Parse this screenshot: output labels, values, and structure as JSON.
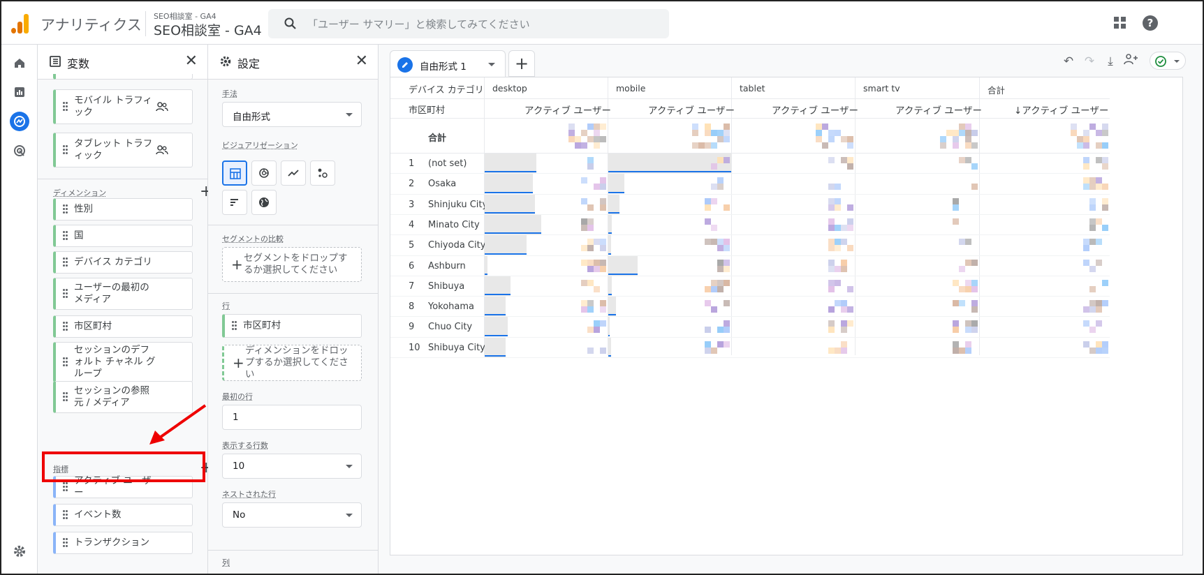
{
  "topbar": {
    "app_name": "アナリティクス",
    "account_small": "SEO相談室 - GA4",
    "account_big": "SEO相談室 - GA4",
    "search_placeholder": "「ユーザー サマリー」と検索してみてください",
    "colors": {
      "logo_orange": "#f9ab00",
      "logo_dark": "#e37400",
      "accent": "#1a73e8"
    }
  },
  "rail": {
    "items": [
      "home-icon",
      "reports-icon",
      "explore-icon",
      "advertising-icon"
    ],
    "settings_icon": "gear-icon"
  },
  "variables": {
    "title": "変数",
    "chips_top": [
      {
        "label": "モバイル トラフィック"
      },
      {
        "label": "タブレット トラフィック"
      }
    ],
    "dimensions_label": "ディメンション",
    "dimensions": [
      "性別",
      "国",
      "デバイス カテゴリ",
      "ユーザーの最初のメディア",
      "市区町村",
      "セッションのデフォルト チャネル グループ",
      "セッションの参照元 / メディア"
    ],
    "metrics_label": "指標",
    "metrics": [
      "アクティブ ユーザー",
      "イベント数",
      "トランザクション"
    ]
  },
  "settings": {
    "title": "設定",
    "method_label": "手法",
    "method_value": "自由形式",
    "viz_label": "ビジュアリゼーション",
    "viz_buttons": [
      "table-icon",
      "donut-icon",
      "line-icon",
      "scatter-icon",
      "bar-icon",
      "globe-icon"
    ],
    "segment_label": "セグメントの比較",
    "segment_drop": "セグメントをドロップするか選択してください",
    "rows_label": "行",
    "rows_chip": "市区町村",
    "rows_drop": "ディメンションをドロップするか選択してください",
    "first_row_label": "最初の行",
    "first_row_value": "1",
    "show_rows_label": "表示する行数",
    "show_rows_value": "10",
    "nested_label": "ネストされた行",
    "nested_value": "No",
    "columns_label": "列"
  },
  "canvas": {
    "tab_label": "自由形式 1",
    "table": {
      "dim_header": "デバイス カテゴリ",
      "row_header": "市区町村",
      "columns": [
        "desktop",
        "mobile",
        "tablet",
        "smart tv",
        "合計"
      ],
      "metric_header": "アクティブ ユーザー",
      "sorted_metric_header": "↓アクティブ ユーザー",
      "total_label": "合計",
      "rows": [
        {
          "n": "1",
          "city": "(not set)",
          "desktop_bar": 0.42,
          "mobile_bar": 1.0
        },
        {
          "n": "2",
          "city": "Osaka",
          "desktop_bar": 0.39,
          "mobile_bar": 0.13
        },
        {
          "n": "3",
          "city": "Shinjuku City",
          "desktop_bar": 0.41,
          "mobile_bar": 0.09
        },
        {
          "n": "4",
          "city": "Minato City",
          "desktop_bar": 0.46,
          "mobile_bar": 0.03
        },
        {
          "n": "5",
          "city": "Chiyoda City",
          "desktop_bar": 0.34,
          "mobile_bar": 0.02
        },
        {
          "n": "6",
          "city": "Ashburn",
          "desktop_bar": 0.02,
          "mobile_bar": 0.24
        },
        {
          "n": "7",
          "city": "Shibuya",
          "desktop_bar": 0.21,
          "mobile_bar": 0.03
        },
        {
          "n": "8",
          "city": "Yokohama",
          "desktop_bar": 0.17,
          "mobile_bar": 0.06
        },
        {
          "n": "9",
          "city": "Chuo City",
          "desktop_bar": 0.19,
          "mobile_bar": 0.01
        },
        {
          "n": "10",
          "city": "Shibuya City",
          "desktop_bar": 0.17,
          "mobile_bar": 0.02
        }
      ]
    }
  }
}
